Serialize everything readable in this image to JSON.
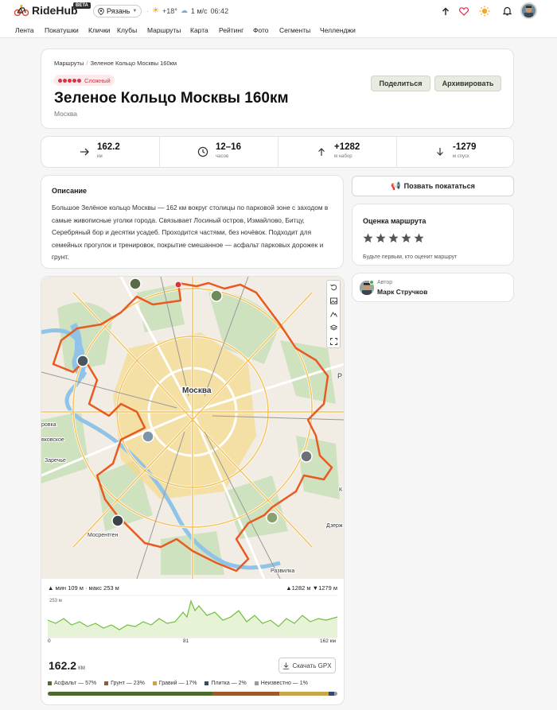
{
  "app": {
    "brand": "RideHub",
    "beta": "BETA",
    "city": "Рязань",
    "temperature": "+18°",
    "wind": "1 м/с",
    "time": "06:42"
  },
  "nav": [
    "Лента",
    "Покатушки",
    "Клички",
    "Клубы",
    "Маршруты",
    "Карта",
    "Рейтинг",
    "Фото",
    "Сегменты",
    "Челленджи"
  ],
  "breadcrumb": {
    "root": "Маршруты",
    "current": "Зеленое Кольцо Москвы 160км"
  },
  "route": {
    "difficulty": "Сложный",
    "difficulty_level": 5,
    "title": "Зеленое Кольцо Москвы 160км",
    "city": "Москва",
    "share_label": "Поделиться",
    "archive_label": "Архивировать"
  },
  "stats": [
    {
      "value": "162.2",
      "label": "км",
      "icon": "arrow-right-icon"
    },
    {
      "value": "12–16",
      "label": "часов",
      "icon": "clock-icon"
    },
    {
      "value": "+1282",
      "label": "м набор",
      "icon": "arrow-up-icon"
    },
    {
      "value": "-1279",
      "label": "м спуск",
      "icon": "arrow-down-icon"
    }
  ],
  "description": {
    "heading": "Описание",
    "text": "Большое Зелёное кольцо Москвы — 162 км вокруг столицы по парковой зоне с заходом в самые живописные уголки города. Связывает Лосиный остров, Измайлово, Битцу, Серебряный бор и десятки усадеб. Проходится частями, без ночёвок. Подходит для семейных прогулок и тренировок, покрытие смешанное — асфальт парковых дорожек и грунт."
  },
  "invite": {
    "label": "Позвать покататься"
  },
  "rating": {
    "heading": "Оценка маршрута",
    "stars": 5,
    "hint": "Будьте первым, кто оценит маршрут"
  },
  "author": {
    "label": "Автор",
    "name": "Марк Стручков"
  },
  "map": {
    "center_label": "Москва",
    "labels": [
      "Заречье",
      "Мосрентген",
      "Развилка",
      "Дзерж",
      "ровка",
      "вковское",
      "К",
      "Р"
    ]
  },
  "elevation": {
    "summary": "мин 109 м · макс 253 м",
    "gain": "▲1282 м",
    "loss": "▼1279 м",
    "y_tick": "253 м",
    "x_ticks": [
      "0",
      "81",
      "162 км"
    ]
  },
  "distance": {
    "value": "162.2",
    "unit": "км",
    "gpx_label": "Скачать GPX"
  },
  "surfaces": [
    {
      "label": "Асфальт — 57%",
      "pct": 57,
      "color": "#4e6b2e"
    },
    {
      "label": "Грунт — 23%",
      "pct": 23,
      "color": "#9b5a2c"
    },
    {
      "label": "Гравий — 17%",
      "pct": 17,
      "color": "#c9a54a"
    },
    {
      "label": "Плитка — 2%",
      "pct": 2,
      "color": "#2f4a7a"
    },
    {
      "label": "Неизвестно — 1%",
      "pct": 1,
      "color": "#9a9a9a"
    }
  ]
}
